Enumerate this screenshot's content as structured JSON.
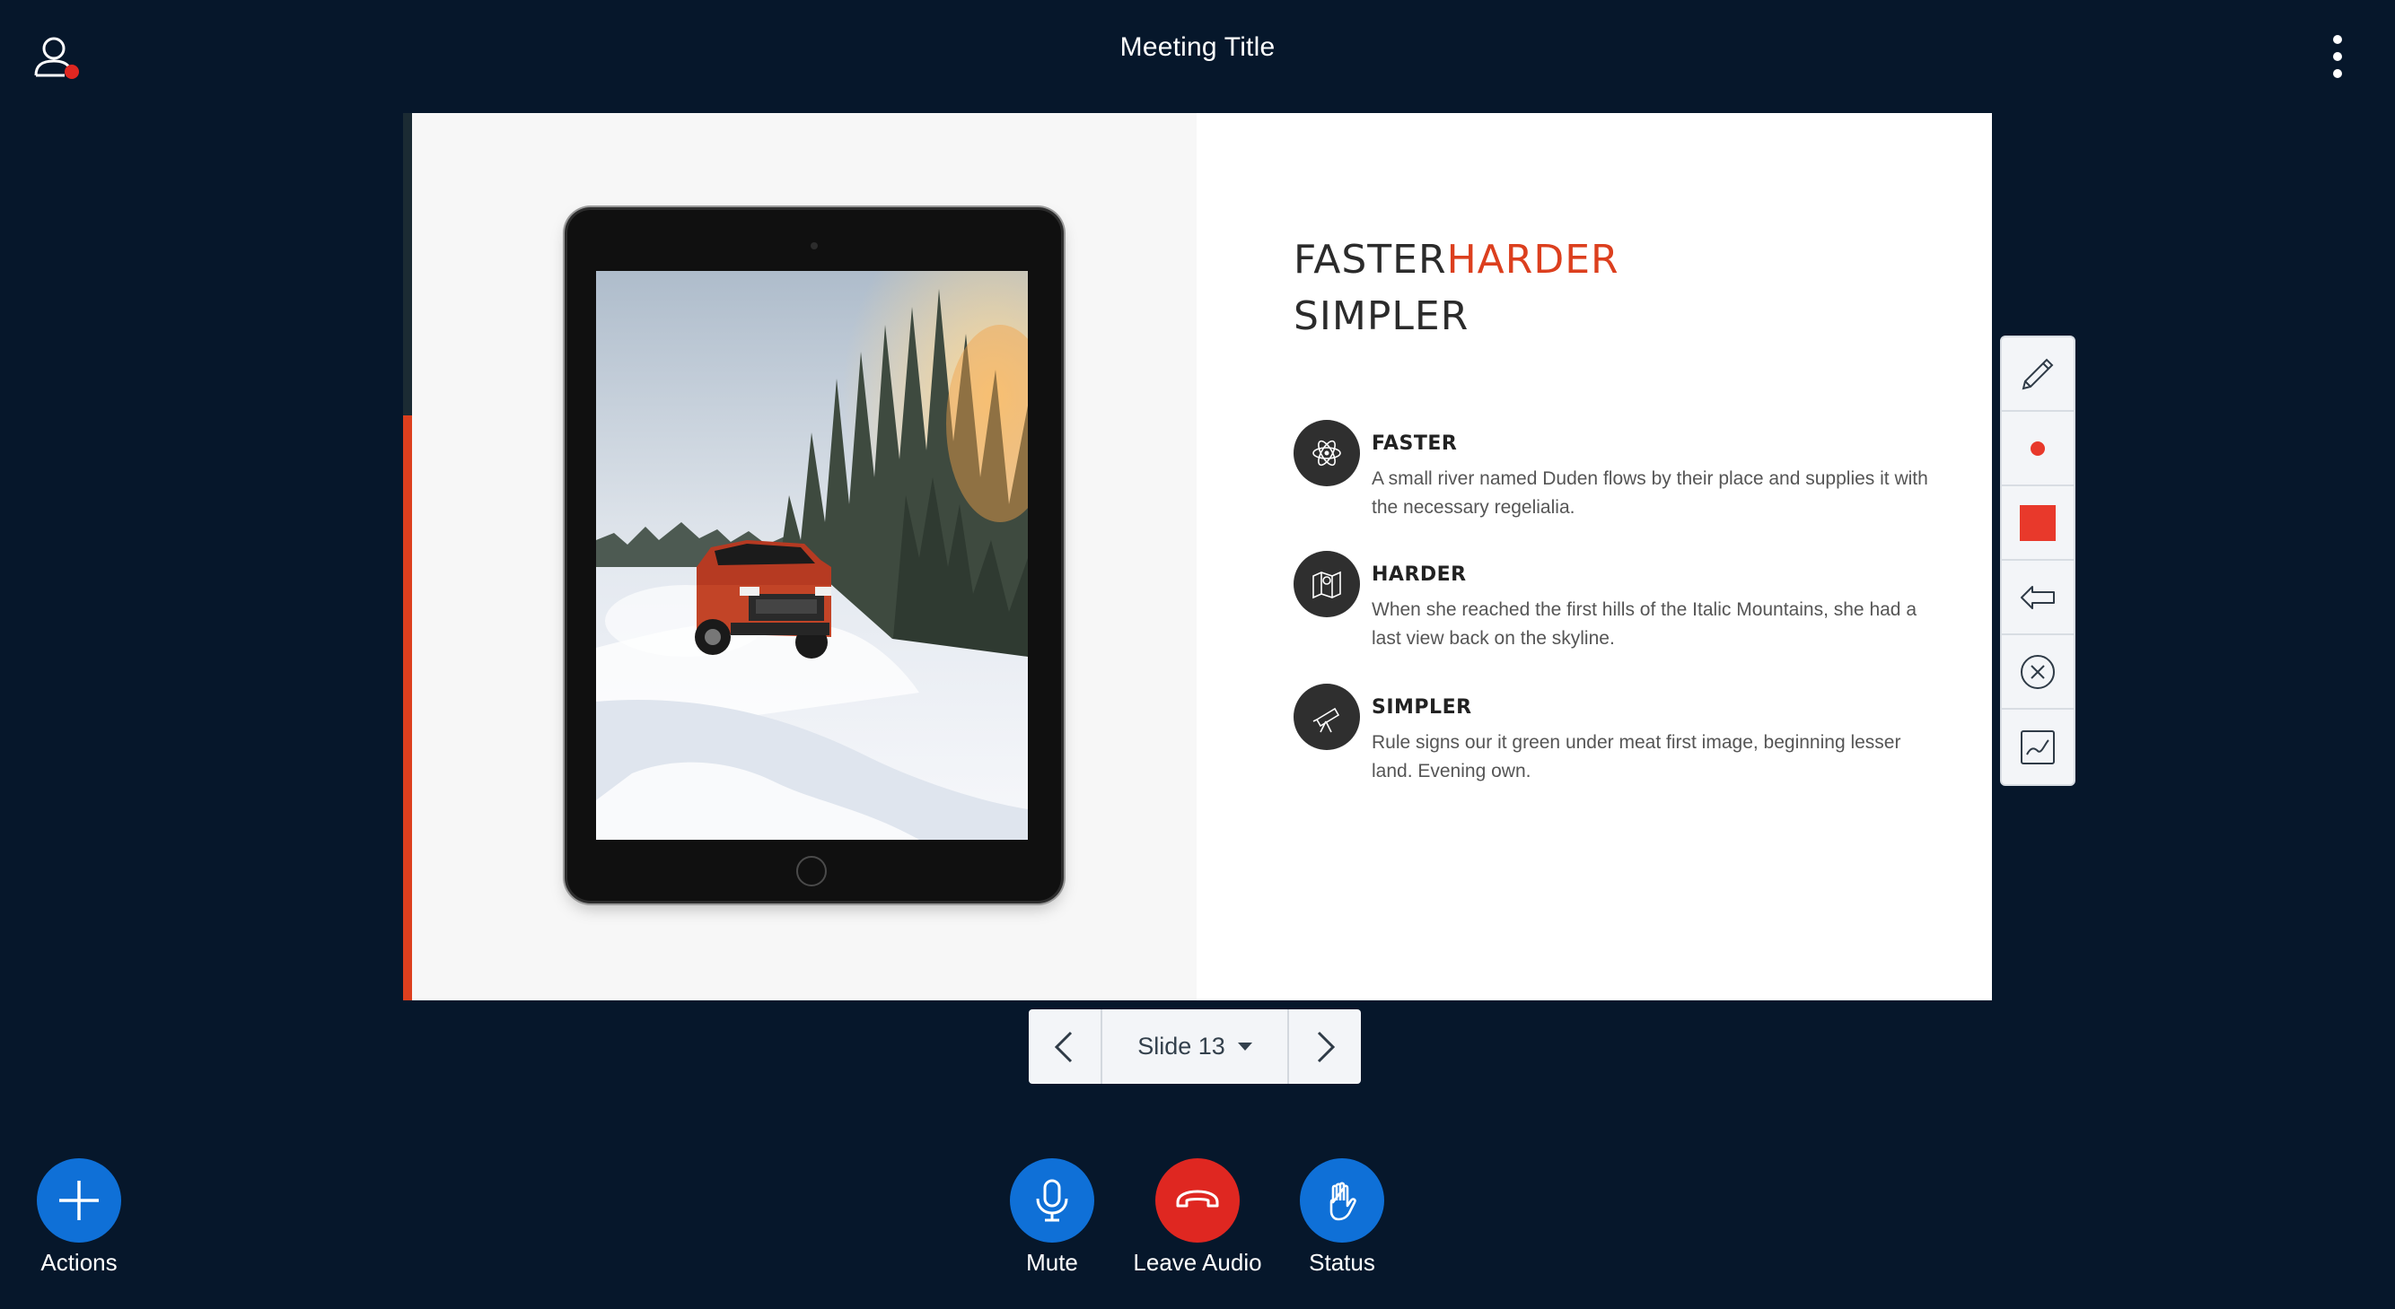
{
  "header": {
    "meeting_title": "Meeting Title",
    "user_icon": "user-icon",
    "status_dot_color": "#df2721",
    "options_icon": "more-vertical-icon"
  },
  "slide": {
    "headline_line1_part1": "FASTER",
    "headline_line1_part2": "HARDER",
    "headline_line2": "SIMPLER",
    "accent_color": "#dc3f1e",
    "features": [
      {
        "title": "FASTER",
        "text": "A small river named Duden flows by their place and supplies it with the necessary regelialia.",
        "icon": "atom-icon"
      },
      {
        "title": "HARDER",
        "text": "When she reached the first hills of the Italic Mountains, she had a last view back on the skyline.",
        "icon": "map-icon"
      },
      {
        "title": "SIMPLER",
        "text": "Rule signs our it green under meat first image, beginning lesser land. Evening own.",
        "icon": "telescope-icon"
      }
    ]
  },
  "annotation_tools": [
    {
      "name": "pencil-icon"
    },
    {
      "name": "thickness-dot-icon",
      "color": "#e8392b"
    },
    {
      "name": "color-swatch-icon",
      "color": "#e8392b"
    },
    {
      "name": "undo-icon"
    },
    {
      "name": "clear-icon"
    },
    {
      "name": "whiteboard-icon"
    }
  ],
  "slide_nav": {
    "current_label": "Slide 13",
    "prev_icon": "chevron-left-icon",
    "next_icon": "chevron-right-icon"
  },
  "actions_bar": {
    "actions_label": "Actions",
    "mute_label": "Mute",
    "leave_audio_label": "Leave Audio",
    "status_label": "Status",
    "primary_color": "#0f70d7",
    "danger_color": "#df2721"
  }
}
